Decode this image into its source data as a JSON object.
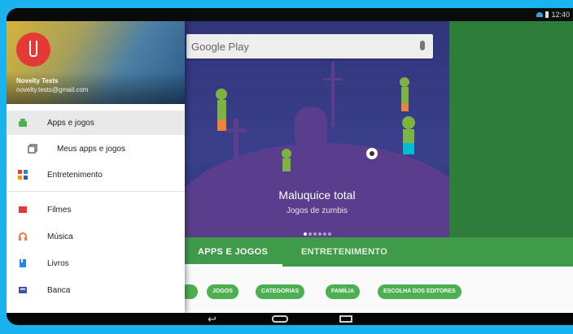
{
  "status": {
    "time": "12:40"
  },
  "search": {
    "placeholder": "Google Play"
  },
  "hero": {
    "title": "Maluquice total",
    "subtitle": "Jogos de zumbis"
  },
  "tabs": [
    {
      "label": "APPS E JOGOS"
    },
    {
      "label": "ENTRETENIMENTO"
    }
  ],
  "chips": [
    "",
    "JOGOS",
    "CATEGORIAS",
    "FAMÍLIA",
    "ESCOLHA DOS EDITORES"
  ],
  "account": {
    "name": "Novelty Tests",
    "email": "novelty.tests@gmail.com"
  },
  "drawer": {
    "items": [
      {
        "label": "Apps e jogos",
        "icon": "android-icon",
        "color": "#4caf50"
      },
      {
        "label": "Meus apps e jogos",
        "icon": "my-apps-icon",
        "color": "#616161"
      },
      {
        "label": "Entretenimento",
        "icon": "entertainment-icon",
        "color": "#e53935"
      },
      {
        "label": "Filmes",
        "icon": "movies-icon",
        "color": "#e53935"
      },
      {
        "label": "Música",
        "icon": "headphones-icon",
        "color": "#ff7043"
      },
      {
        "label": "Livros",
        "icon": "books-icon",
        "color": "#1e88e5"
      },
      {
        "label": "Banca",
        "icon": "newsstand-icon",
        "color": "#3f51b5"
      }
    ]
  },
  "colors": {
    "accent": "#4caf50",
    "tab_bar": "#3f9a4a",
    "avatar": "#e53935"
  }
}
